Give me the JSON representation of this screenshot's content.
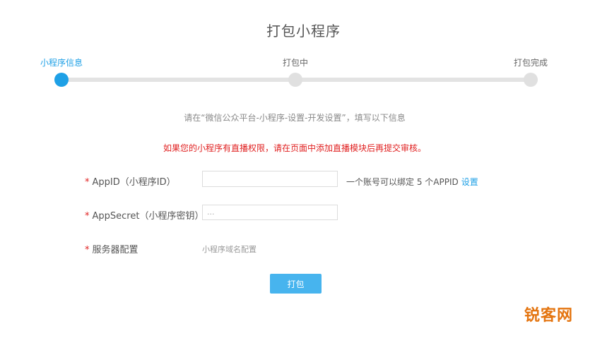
{
  "page": {
    "title": "打包小程序"
  },
  "steps": [
    {
      "label": "小程序信息",
      "active": true
    },
    {
      "label": "打包中",
      "active": false
    },
    {
      "label": "打包完成",
      "active": false
    }
  ],
  "hint": "请在“微信公众平台-小程序-设置-开发设置”，填写以下信息",
  "warning": "如果您的小程序有直播权限，请在页面中添加直播模块后再提交审核。",
  "form": {
    "required_mark": "*",
    "appid": {
      "label": "AppID（小程序ID）",
      "value": "",
      "note": "一个账号可以绑定 5 个APPID",
      "note_link": "设置"
    },
    "appsecret": {
      "label": "AppSecret（小程序密钥）",
      "value": "..."
    },
    "server": {
      "label": "服务器配置",
      "domain_config": "小程序域名配置"
    }
  },
  "actions": {
    "pack_label": "打包"
  },
  "watermark": "锐客网",
  "colors": {
    "accent": "#1ea0e6",
    "button": "#47b4ee",
    "warning": "#e02020",
    "watermark": "#e4740f"
  }
}
